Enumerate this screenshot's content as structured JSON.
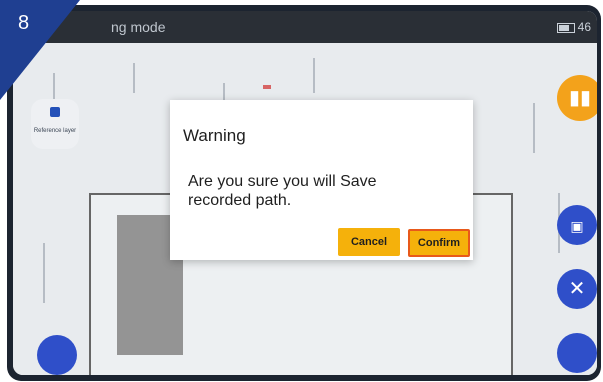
{
  "step_badge": "8",
  "statusbar": {
    "title": "ng mode",
    "battery_text": "46"
  },
  "layer_button": {
    "label": "Reference layer"
  },
  "dialog": {
    "title": "Warning",
    "message": "Are you sure you will Save recorded path.",
    "cancel_label": "Cancel",
    "confirm_label": "Confirm"
  },
  "icons": {
    "book": "book-icon",
    "save": "save-icon",
    "close": "close-icon",
    "layer": "layer-icon"
  },
  "colors": {
    "accent": "#f5b10b",
    "confirm_border": "#e8591a",
    "badge_blue": "#1f3f91",
    "round_button": "#2f4fc9"
  }
}
